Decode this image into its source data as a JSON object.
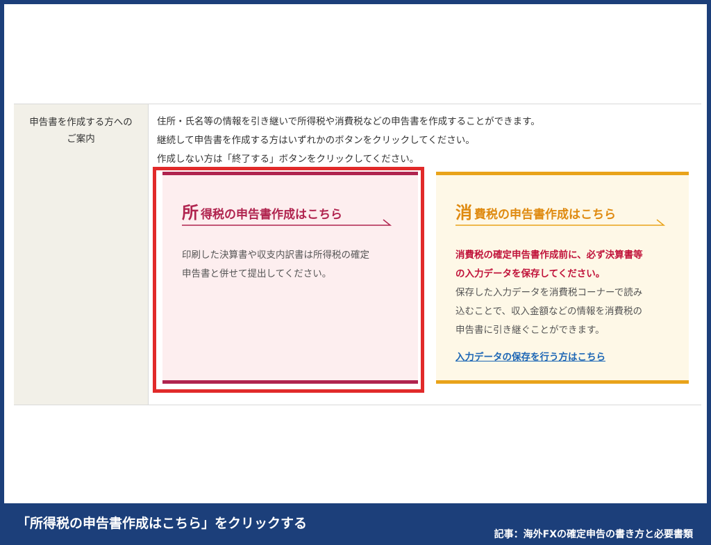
{
  "table": {
    "header_line1": "申告書を作成する方への",
    "header_line2": "ご案内",
    "intro": [
      "住所・氏名等の情報を引き継いで所得税や消費税などの申告書を作成することができます。",
      "継続して申告書を作成する方はいずれかのボタンをクリックしてください。",
      "作成しない方は「終了する」ボタンをクリックしてください。"
    ]
  },
  "income_card": {
    "first_char": "所",
    "heading_rest": "得税の申告書作成はこちら",
    "text": [
      "印刷した決算書や収支内訳書は所得税の確定",
      "申告書と併せて提出してください。"
    ],
    "color": "#b0244f",
    "highlight_color": "#e12a2a"
  },
  "consumption_card": {
    "first_char": "消",
    "heading_rest": "費税の申告書作成はこちら",
    "warning": [
      "消費税の確定申告書作成前に、必ず決算書等",
      "の入力データを保存してください。"
    ],
    "text": [
      "保存した入力データを消費税コーナーで読み",
      "込むことで、収入金額などの情報を消費税の",
      "申告書に引き継ぐことができます。"
    ],
    "link": "入力データの保存を行う方はこちら",
    "color": "#e9a31a"
  },
  "caption": {
    "instruction": "「所得税の申告書作成はこちら」をクリックする",
    "article": "記事：海外FXの確定申告の書き方と必要書類"
  },
  "colors": {
    "frame": "#1c3f7a"
  }
}
